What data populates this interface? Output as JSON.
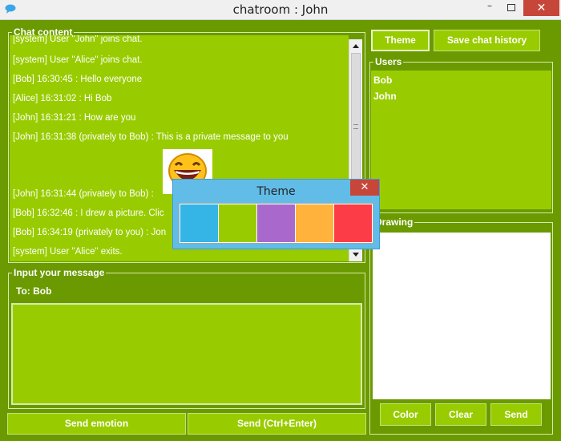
{
  "window": {
    "title": "chatroom : John",
    "minimize": "–",
    "close": "✕"
  },
  "chat": {
    "group_title": "Chat content",
    "lines": [
      "[system] User \"John\" joins chat.",
      "[system] User \"Alice\" joins chat.",
      "[Bob] 16:30:45 : Hello everyone",
      "[Alice] 16:31:02 : Hi Bob",
      "[John] 16:31:21 : How are you",
      "[John] 16:31:38 (privately to Bob) : This is a private message to you",
      "[John] 16:31:44 (privately to Bob) :",
      "[Bob] 16:32:46 : I drew a picture. Clic",
      "[Bob] 16:34:19 (privately to you) : Jon",
      "[system] User \"Alice\" exits."
    ]
  },
  "input": {
    "group_title": "Input your message",
    "to_label": "To:",
    "to_value": "Bob",
    "send_emotion": "Send emotion",
    "send": "Send (Ctrl+Enter)"
  },
  "toolbar": {
    "theme": "Theme",
    "save_history": "Save chat history"
  },
  "users": {
    "group_title": "Users",
    "items": [
      "Bob",
      "John"
    ]
  },
  "drawing": {
    "group_title": "Drawing",
    "color": "Color",
    "clear": "Clear",
    "send": "Send"
  },
  "theme_dialog": {
    "title": "Theme",
    "close": "✕",
    "swatches": [
      "#35b4e6",
      "#99cc00",
      "#a868cc",
      "#ffb23c",
      "#fc3c46"
    ]
  }
}
